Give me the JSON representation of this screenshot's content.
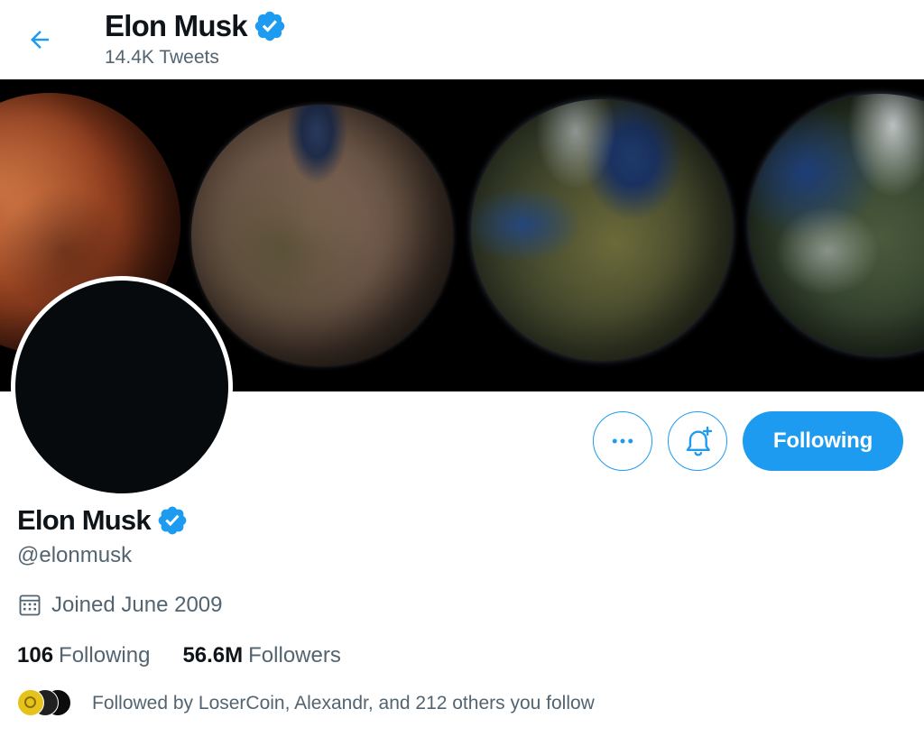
{
  "header": {
    "back_icon": "arrow-left-icon",
    "name": "Elon Musk",
    "verified_icon": "verified-badge-icon",
    "tweet_count": "14.4K Tweets"
  },
  "banner": {
    "description_icon": "banner-image"
  },
  "actions": {
    "more_icon": "more-horizontal-icon",
    "notify_icon": "bell-plus-icon",
    "following_label": "Following"
  },
  "profile": {
    "name": "Elon Musk",
    "handle": "@elonmusk",
    "joined_icon": "calendar-icon",
    "joined": "Joined June 2009",
    "following_count": "106",
    "following_label": "Following",
    "followers_count": "56.6M",
    "followers_label": "Followers",
    "followed_by": "Followed by LoserCoin, Alexandr, and 212 others you follow"
  },
  "colors": {
    "accent": "#1d9bf0",
    "text_primary": "#0f1419",
    "text_secondary": "#536471"
  }
}
